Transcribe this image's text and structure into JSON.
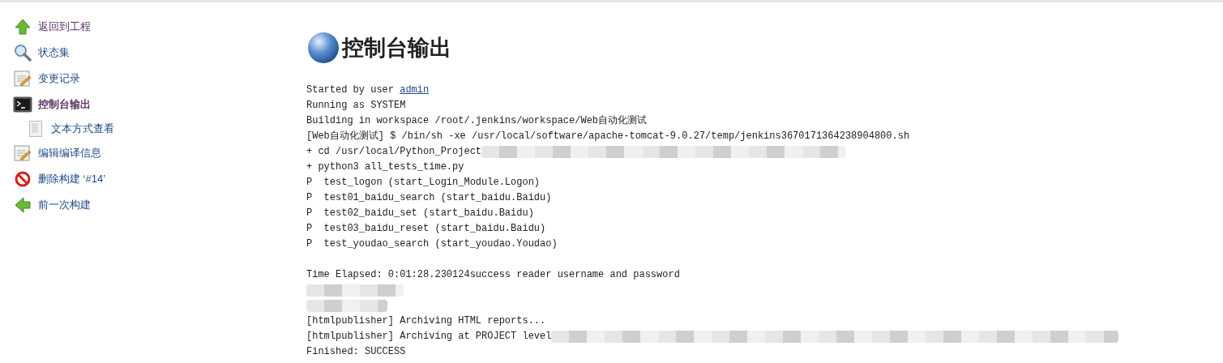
{
  "sidebar": {
    "items": [
      {
        "kind": "up",
        "label": "返回到工程",
        "visited": true,
        "selected": false
      },
      {
        "kind": "search",
        "label": "状态集",
        "visited": false,
        "selected": false
      },
      {
        "kind": "notepad",
        "label": "变更记录",
        "visited": false,
        "selected": false
      },
      {
        "kind": "terminal",
        "label": "控制台输出",
        "visited": true,
        "selected": true,
        "children": [
          {
            "kind": "document",
            "label": "文本方式查看",
            "visited": false,
            "selected": false
          }
        ]
      },
      {
        "kind": "notepad",
        "label": "编辑编译信息",
        "visited": false,
        "selected": false
      },
      {
        "kind": "delete",
        "label": "删除构建 ‘#14’",
        "visited": false,
        "selected": false
      },
      {
        "kind": "back",
        "label": "前一次构建",
        "visited": false,
        "selected": false
      }
    ]
  },
  "page": {
    "title": "控制台输出"
  },
  "console": {
    "lines": [
      {
        "kind": "text",
        "text": "Started by user ",
        "link": "admin",
        "redacted": false
      },
      {
        "kind": "text",
        "text": "Running as SYSTEM",
        "redacted": false
      },
      {
        "kind": "text",
        "text": "Building in workspace /root/.jenkins/workspace/Web自动化测试",
        "redacted": false
      },
      {
        "kind": "text",
        "text": "[Web自动化测试] $ /bin/sh -xe /usr/local/software/apache-tomcat-9.0.27/temp/jenkins3670171364238904800.sh",
        "redacted": false
      },
      {
        "kind": "text",
        "text": "+ cd /usr/local/Python_Project",
        "redacted": true
      },
      {
        "kind": "text",
        "text": "+ python3 all_tests_time.py",
        "redacted": false
      },
      {
        "kind": "text",
        "text": "P  test_logon (start_Login_Module.Logon)",
        "redacted": false
      },
      {
        "kind": "text",
        "text": "P  test01_baidu_search (start_baidu.Baidu)",
        "redacted": false
      },
      {
        "kind": "text",
        "text": "P  test02_baidu_set (start_baidu.Baidu)",
        "redacted": false
      },
      {
        "kind": "text",
        "text": "P  test03_baidu_reset (start_baidu.Baidu)",
        "redacted": false
      },
      {
        "kind": "text",
        "text": "P  test_youdao_search (start_youdao.Youdao)",
        "redacted": false
      },
      {
        "kind": "blank"
      },
      {
        "kind": "text",
        "text": "Time Elapsed: 0:01:28.230124success reader username and password",
        "redacted": false
      },
      {
        "kind": "redacted"
      },
      {
        "kind": "redacted"
      },
      {
        "kind": "text",
        "text": "[htmlpublisher] Archiving HTML reports...",
        "redacted": false
      },
      {
        "kind": "text",
        "text": "[htmlpublisher] Archiving at PROJECT level",
        "redacted": true
      },
      {
        "kind": "text",
        "text": "Finished: SUCCESS",
        "redacted": false
      }
    ]
  }
}
